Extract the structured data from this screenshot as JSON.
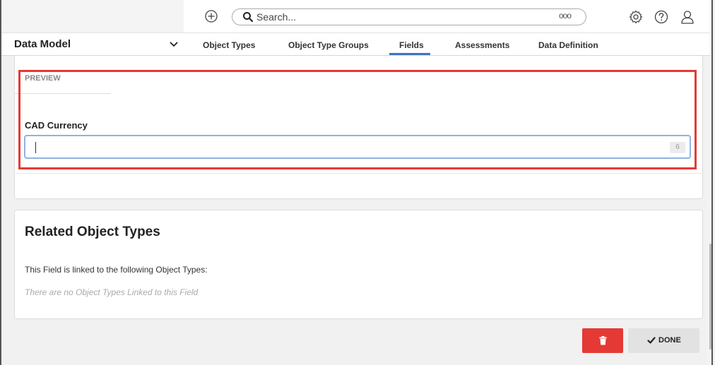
{
  "topbar": {
    "search_placeholder": "Search...",
    "more_label": "ooo",
    "icons": [
      "add-icon",
      "search-icon",
      "more-icon",
      "gear-icon",
      "help-icon",
      "user-icon"
    ]
  },
  "nav": {
    "title": "Data Model",
    "tabs": [
      {
        "label": "Object Types"
      },
      {
        "label": "Object Type Groups"
      },
      {
        "label": "Fields",
        "active": true
      },
      {
        "label": "Assessments"
      },
      {
        "label": "Data Definition"
      }
    ]
  },
  "preview": {
    "section_label": "PREVIEW",
    "field_label": "CAD Currency",
    "field_value": "",
    "counter": "6"
  },
  "related": {
    "title": "Related Object Types",
    "description": "This Field is linked to the following Object Types:",
    "empty_text": "There are no Object Types Linked to this Field"
  },
  "footer": {
    "done_label": "DONE"
  },
  "colors": {
    "accent": "#3a75c4",
    "danger": "#e53935",
    "highlight": "#e53935"
  }
}
